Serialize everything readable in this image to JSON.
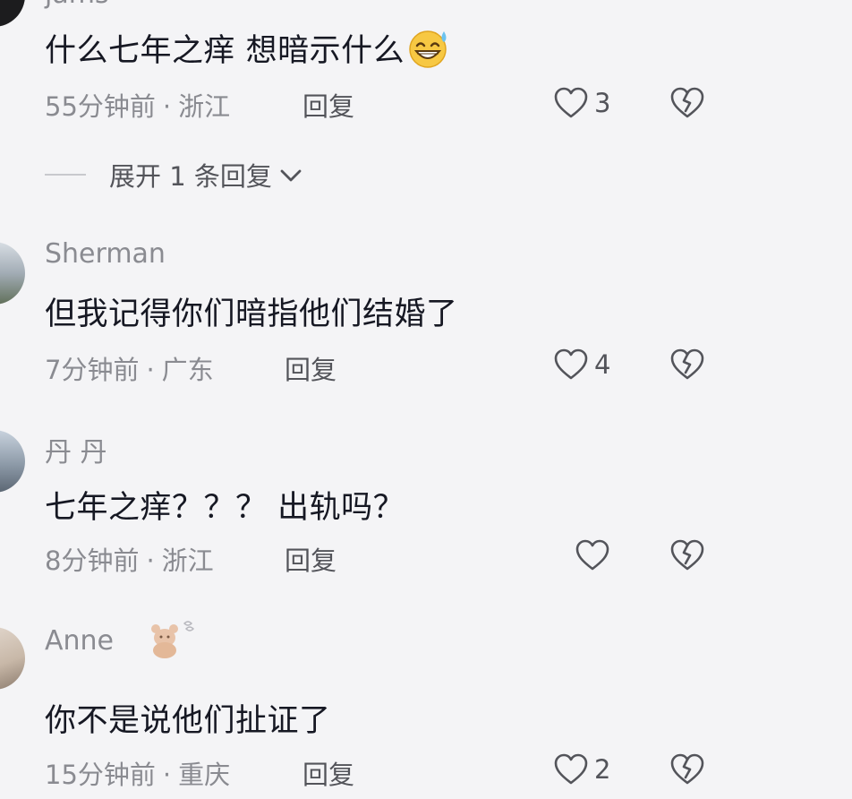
{
  "comments": [
    {
      "username": "jams",
      "text": "什么七年之痒 想暗示什么",
      "time": "55分钟前",
      "location": "浙江",
      "reply_label": "回复",
      "likes": "3",
      "emoji": "grinning-sweat-emoji"
    },
    {
      "username": "Sherman",
      "text": "但我记得你们暗指他们结婚了",
      "time": "7分钟前",
      "location": "广东",
      "reply_label": "回复",
      "likes": "4"
    },
    {
      "username": "丹 丹",
      "text": "七年之痒？？？ 出轨吗？",
      "time": "8分钟前",
      "location": "浙江",
      "reply_label": "回复",
      "likes": ""
    },
    {
      "username": "Anne",
      "text": "你不是说他们扯证了",
      "time": "15分钟前",
      "location": "重庆",
      "reply_label": "回复",
      "likes": "2",
      "badge": "bear-sticker-icon"
    }
  ],
  "expand_replies": {
    "label": "展开 1 条回复"
  },
  "meta_separator": "·",
  "colors": {
    "background": "#f4f4f6",
    "primary_text": "#161823",
    "secondary_text": "#8a8b91",
    "icon": "#53545a"
  },
  "icons": [
    "heart-outline-icon",
    "broken-heart-icon",
    "chevron-down-icon"
  ]
}
